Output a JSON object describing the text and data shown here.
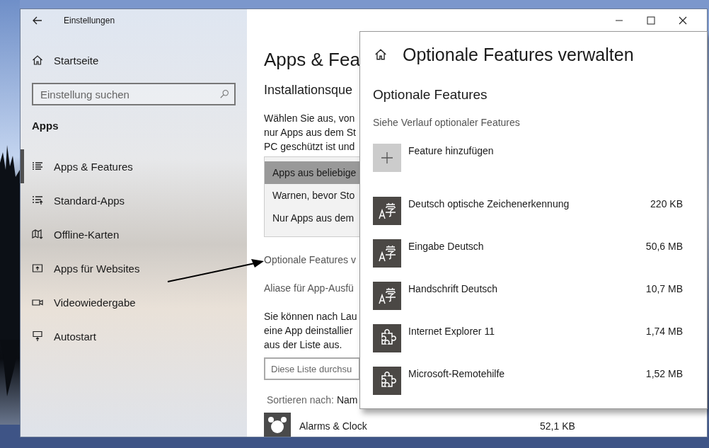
{
  "window": {
    "title": "Einstellungen"
  },
  "sidebar": {
    "home": "Startseite",
    "search": {
      "placeholder": "Einstellung suchen"
    },
    "section": "Apps",
    "items": [
      {
        "label": "Apps & Features",
        "selected": true
      },
      {
        "label": "Standard-Apps",
        "selected": false
      },
      {
        "label": "Offline-Karten",
        "selected": false
      },
      {
        "label": "Apps für Websites",
        "selected": false
      },
      {
        "label": "Videowiedergabe",
        "selected": false
      },
      {
        "label": "Autostart",
        "selected": false
      }
    ]
  },
  "main": {
    "title": "Apps & Fea",
    "subtitle": "Installationsque",
    "paragraph_1": [
      "Wählen Sie aus, von",
      "nur Apps aus dem St",
      "PC geschützt ist und"
    ],
    "dropdown": [
      {
        "label": "Apps aus beliebige",
        "selected": true
      },
      {
        "label": "Warnen, bevor Sto",
        "selected": false
      },
      {
        "label": "Nur Apps aus dem",
        "selected": false
      }
    ],
    "link_1": "Optionale Features v",
    "link_2": "Aliase für App-Ausfü",
    "paragraph_2": [
      "Sie können nach Lau",
      "eine App deinstallier",
      "aus der Liste aus."
    ],
    "list_search": {
      "placeholder": "Diese Liste durchsu"
    },
    "sort_label": "Sortieren nach:",
    "sort_value": "Nam",
    "apps": [
      {
        "name": "Alarms & Clock",
        "size": "52,1 KB"
      }
    ]
  },
  "popup": {
    "title": "Optionale Features verwalten",
    "heading": "Optionale Features",
    "history_link": "Siehe Verlauf optionaler Features",
    "add": "Feature hinzufügen",
    "features": [
      {
        "name": "Deutsch optische Zeichenerkennung",
        "size": "220 KB",
        "kind": "language"
      },
      {
        "name": "Eingabe Deutsch",
        "size": "50,6 MB",
        "kind": "language"
      },
      {
        "name": "Handschrift Deutsch",
        "size": "10,7 MB",
        "kind": "language"
      },
      {
        "name": "Internet Explorer 11",
        "size": "1,74 MB",
        "kind": "puzzle"
      },
      {
        "name": "Microsoft-Remotehilfe",
        "size": "1,52 MB",
        "kind": "puzzle"
      }
    ]
  }
}
